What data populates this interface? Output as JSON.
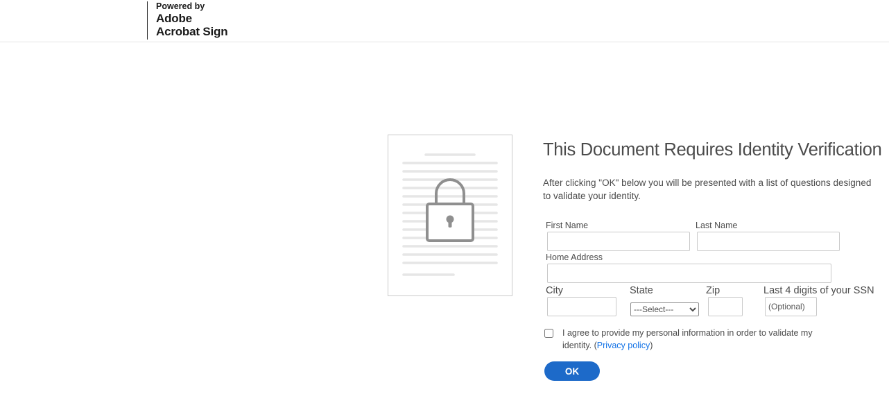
{
  "header": {
    "powered_by": "Powered by",
    "brand_line1": "Adobe",
    "brand_line2": "Acrobat Sign"
  },
  "main": {
    "title": "This Document Requires Identity Verification",
    "description": "After clicking \"OK\" below you will be presented with a list of questions designed to validate your identity.",
    "icon": "locked-document-icon"
  },
  "form": {
    "first_name": {
      "label": "First Name",
      "value": ""
    },
    "last_name": {
      "label": "Last Name",
      "value": ""
    },
    "home_address": {
      "label": "Home Address",
      "value": ""
    },
    "city": {
      "label": "City",
      "value": ""
    },
    "state": {
      "label": "State",
      "selected": "---Select---"
    },
    "zip": {
      "label": "Zip",
      "value": ""
    },
    "ssn": {
      "label": "Last 4 digits of your SSN",
      "placeholder": "(Optional)",
      "value": ""
    },
    "consent": {
      "text": "I agree to provide my personal information in order to validate my identity. (",
      "link": "Privacy policy",
      "after": ")",
      "checked": false
    },
    "ok_label": "OK"
  },
  "colors": {
    "accent": "#1d6ac9",
    "link": "#1473e6",
    "text": "#4b4b4b",
    "border": "#c9c9c9"
  }
}
